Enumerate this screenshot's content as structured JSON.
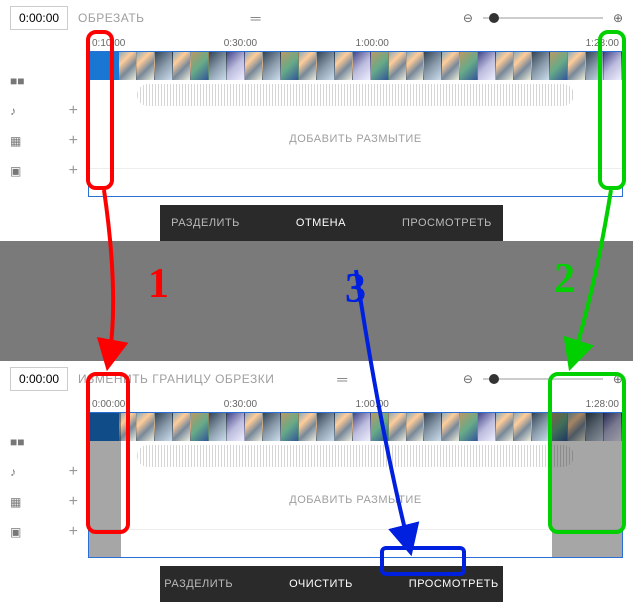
{
  "panel1": {
    "time": "0:00:00",
    "title": "ОБРЕЗАТЬ",
    "ruler": [
      "0:10:00",
      "0:30:00",
      "1:00:00",
      "1:28:00"
    ],
    "blur_label": "ДОБАВИТЬ РАЗМЫТИЕ",
    "actions": {
      "split": "РАЗДЕЛИТЬ",
      "mid": "ОТМЕНА",
      "preview": "ПРОСМОТРЕТЬ"
    }
  },
  "panel2": {
    "time": "0:00:00",
    "title": "ИЗМЕНИТЬ ГРАНИЦУ ОБРЕЗКИ",
    "ruler": [
      "0:00:00",
      "0:30:00",
      "1:00:00",
      "1:28:00"
    ],
    "blur_label": "ДОБАВИТЬ РАЗМЫТИЕ",
    "actions": {
      "split": "РАЗДЕЛИТЬ",
      "mid": "ОЧИСТИТЬ",
      "preview": "ПРОСМОТРЕТЬ"
    }
  },
  "annot": {
    "n1": "1",
    "n2": "2",
    "n3": "3",
    "red": "#ff0000",
    "green": "#00d000",
    "blue": "#0020e0"
  }
}
